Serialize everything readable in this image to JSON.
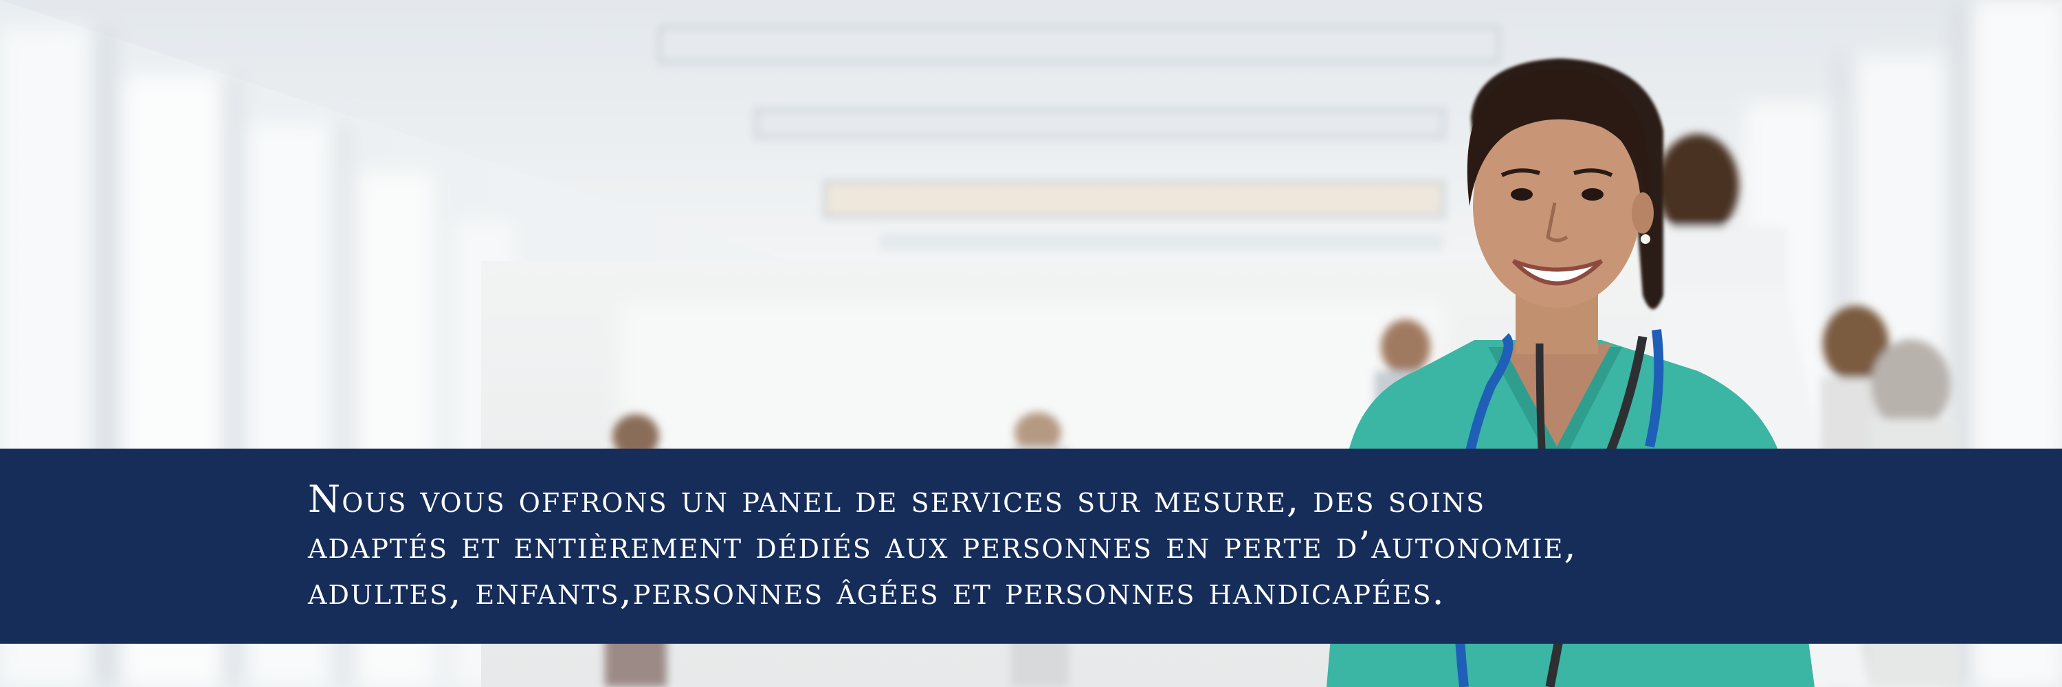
{
  "hero": {
    "image_alt": "Smiling nurse in teal scrubs with stethoscope in a bright hospital corridor",
    "banner_color": "#162d59",
    "text_color": "#ffffff",
    "lines": [
      "Nous vous offrons un panel de services sur mesure, des soins",
      "adaptés et entièrement dédiés aux personnes en perte d’autonomie,",
      "adultes, enfants,personnes âgées et personnes handicapées."
    ]
  }
}
